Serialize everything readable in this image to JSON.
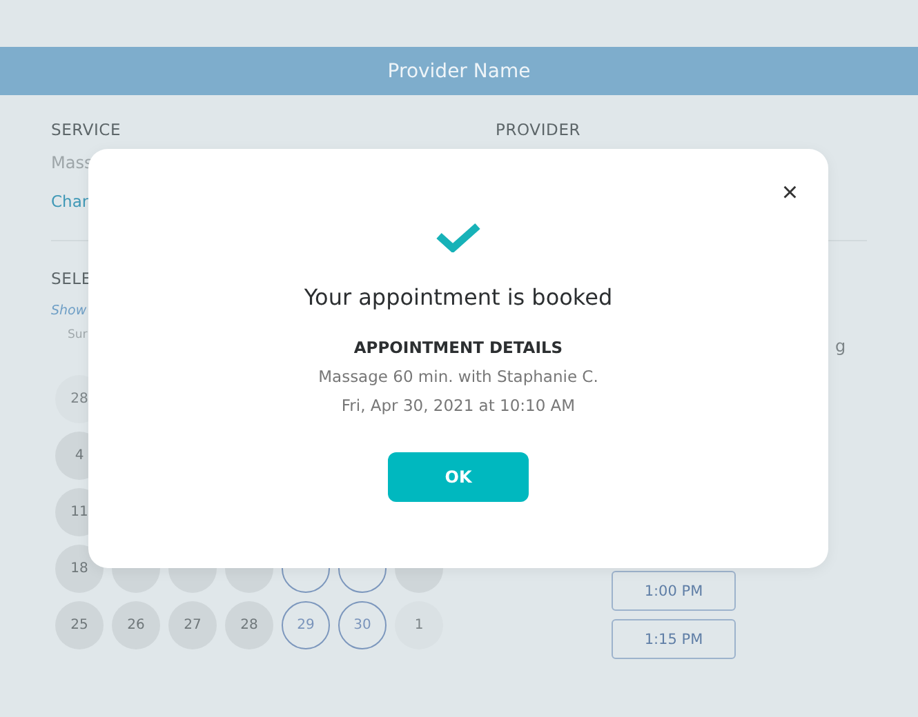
{
  "header": {
    "title": "Provider Name"
  },
  "service": {
    "label": "SERVICE",
    "value": "Mass",
    "link": "Char"
  },
  "provider": {
    "label": "PROVIDER"
  },
  "date_section": {
    "label": "SELE",
    "note": "Show",
    "weekday": "Sur"
  },
  "calendar_rows": [
    [
      {
        "label": "28",
        "kind": "other"
      }
    ],
    [
      {
        "label": "4",
        "kind": "unavailable"
      }
    ],
    [
      {
        "label": "11",
        "kind": "unavailable"
      }
    ],
    [
      {
        "label": "18",
        "kind": "unavailable"
      },
      {
        "kind": "unavailable"
      },
      {
        "kind": "unavailable"
      },
      {
        "kind": "unavailable"
      },
      {
        "kind": "available"
      },
      {
        "kind": "available"
      },
      {
        "kind": "unavailable"
      }
    ],
    [
      {
        "label": "25",
        "kind": "unavailable"
      },
      {
        "label": "26",
        "kind": "unavailable"
      },
      {
        "label": "27",
        "kind": "unavailable"
      },
      {
        "label": "28",
        "kind": "unavailable"
      },
      {
        "label": "29",
        "kind": "available"
      },
      {
        "label": "30",
        "kind": "available"
      },
      {
        "label": "1",
        "kind": "other"
      }
    ]
  ],
  "times_fragment": "g",
  "time_slots": [
    "1:00 PM",
    "1:15 PM"
  ],
  "modal": {
    "close": "×",
    "title": "Your appointment is booked",
    "details_heading": "APPOINTMENT DETAILS",
    "details": [
      "Massage 60 min. with Staphanie C.",
      "Fri, Apr 30, 2021 at 10:10 AM"
    ],
    "button": "OK"
  }
}
